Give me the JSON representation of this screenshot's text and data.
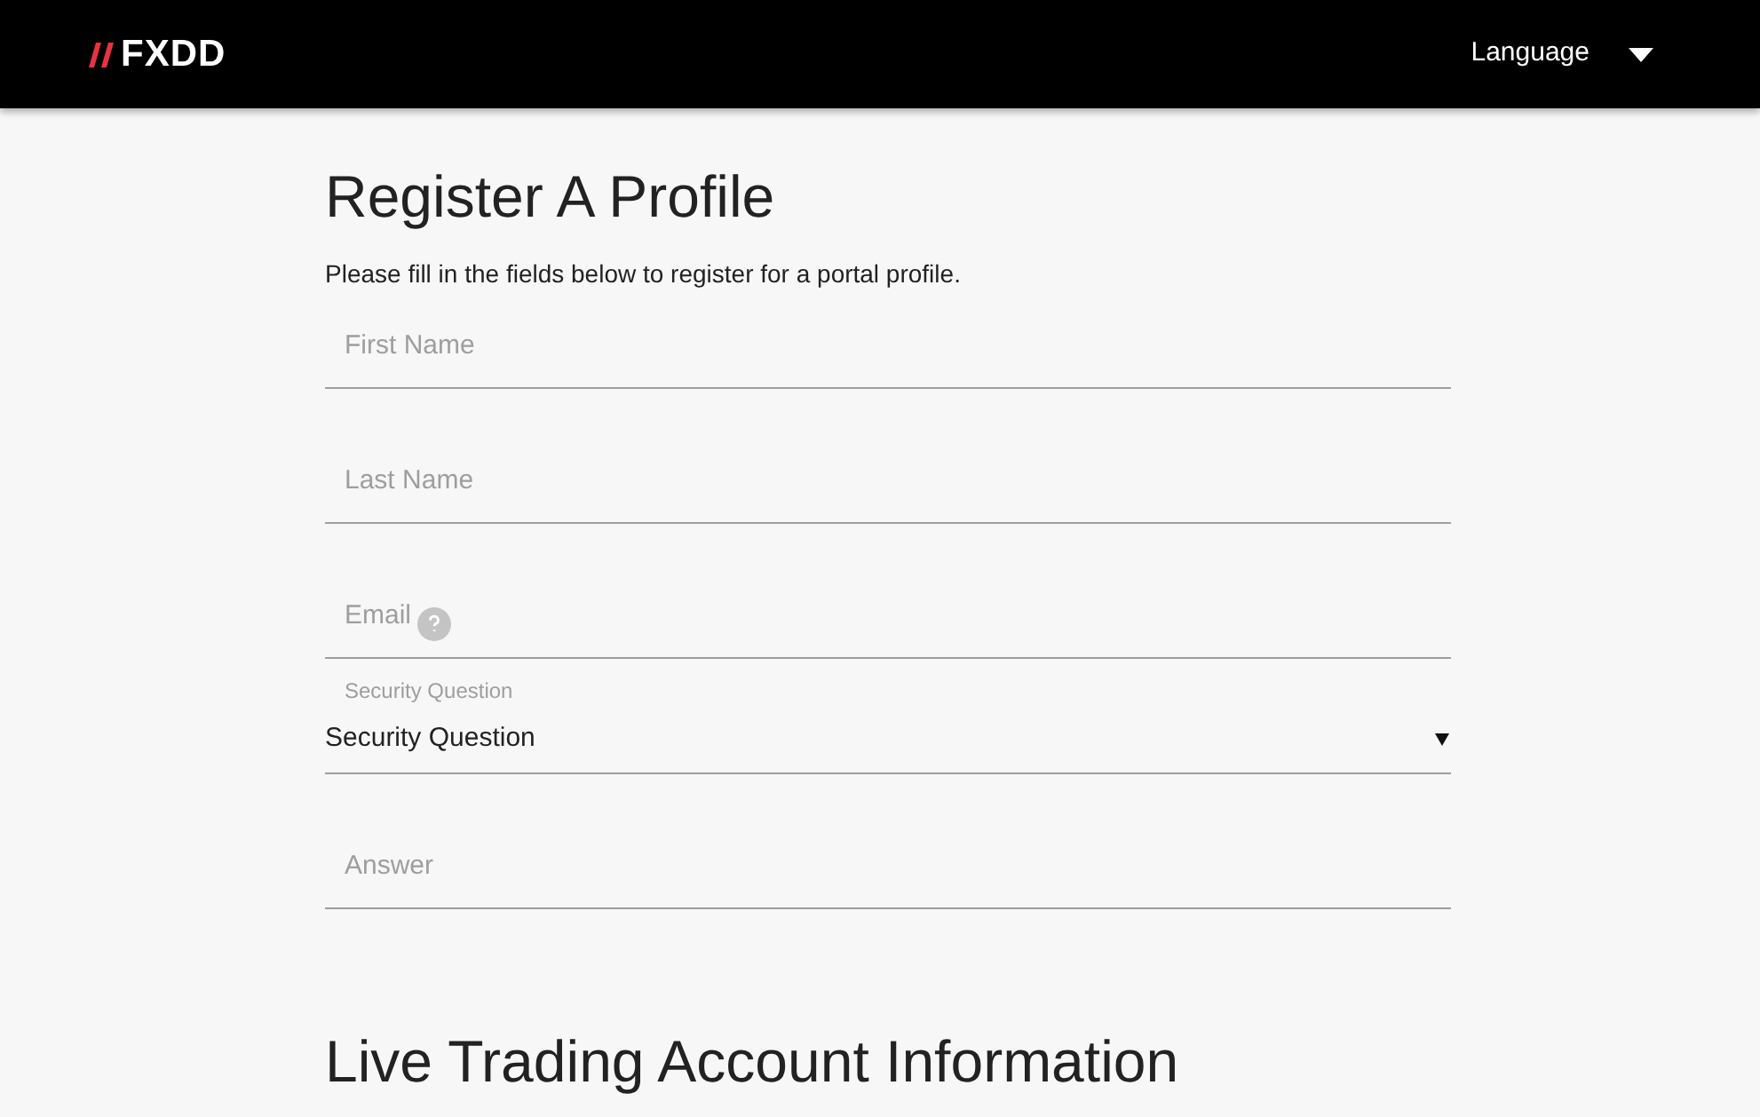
{
  "header": {
    "logo": "FXDD",
    "language": "Language"
  },
  "title": "Register A Profile",
  "intro": "Please fill in the fields below to register for a portal profile.",
  "fields": [
    {
      "kind": "text",
      "placeholder": "First Name",
      "help": false
    },
    {
      "kind": "text",
      "placeholder": "Last Name",
      "help": false
    },
    {
      "kind": "text",
      "placeholder": "Email",
      "help": true
    },
    {
      "kind": "select",
      "label": "Security Question",
      "value": "Security Question"
    },
    {
      "kind": "text",
      "placeholder": "Answer",
      "help": false
    }
  ],
  "section_title": "Live Trading Account Information"
}
